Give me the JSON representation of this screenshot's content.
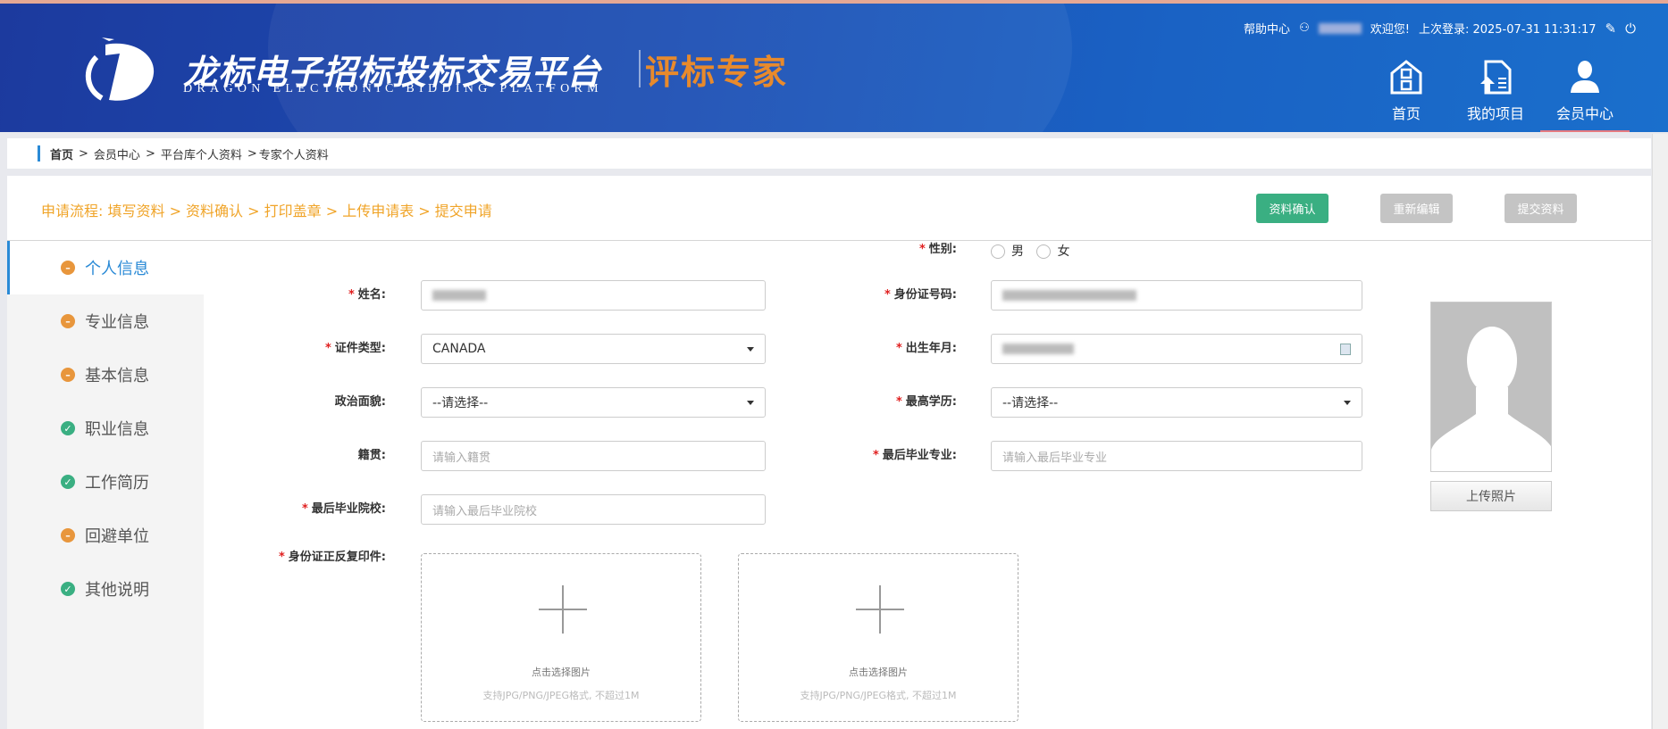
{
  "header": {
    "title_cn": "龙标电子招标投标交易平台",
    "title_en": "DRAGON ELECTRONIC BIDDING PLATFORM",
    "subtitle": "评标专家",
    "help": "帮助中心",
    "welcome": "欢迎您!",
    "last_login_label": "上次登录:",
    "last_login_time": "2025-07-31 11:31:17",
    "nav": [
      {
        "label": "首页"
      },
      {
        "label": "我的项目"
      },
      {
        "label": "会员中心"
      }
    ]
  },
  "breadcrumb": [
    "首页",
    "会员中心",
    "平台库个人资料",
    "专家个人资料"
  ],
  "flow": "申请流程: 填写资料 > 资料确认 > 打印盖章 > 上传申请表 > 提交申请",
  "buttons": {
    "confirm": "资料确认",
    "reedit": "重新编辑",
    "submit": "提交资料"
  },
  "colors": {
    "confirm": "#3aaf82",
    "disabled": "#c4c4c4",
    "accent": "#2a8ad6",
    "flow": "#f0a428"
  },
  "sidebar": [
    {
      "label": "个人信息",
      "status": "incomplete"
    },
    {
      "label": "专业信息",
      "status": "incomplete"
    },
    {
      "label": "基本信息",
      "status": "incomplete"
    },
    {
      "label": "职业信息",
      "status": "complete"
    },
    {
      "label": "工作简历",
      "status": "complete"
    },
    {
      "label": "回避单位",
      "status": "incomplete"
    },
    {
      "label": "其他说明",
      "status": "complete"
    }
  ],
  "form": {
    "name_label": "姓名:",
    "id_type_label": "证件类型:",
    "id_type_value": "CANADA",
    "political_label": "政治面貌:",
    "political_value": "--请选择--",
    "native_label": "籍贯:",
    "native_placeholder": "请输入籍贯",
    "school_label": "最后毕业院校:",
    "school_placeholder": "请输入最后毕业院校",
    "gender_label": "性别:",
    "gender_male": "男",
    "gender_female": "女",
    "id_no_label": "身份证号码:",
    "birth_label": "出生年月:",
    "edu_label": "最高学历:",
    "edu_value": "--请选择--",
    "major_label": "最后毕业专业:",
    "major_placeholder": "请输入最后毕业专业",
    "idcopy_label": "身份证正反复印件:",
    "upload_hint": "点击选择图片",
    "upload_format": "支持JPG/PNG/JPEG格式, 不超过1M",
    "upload_photo": "上传照片"
  }
}
